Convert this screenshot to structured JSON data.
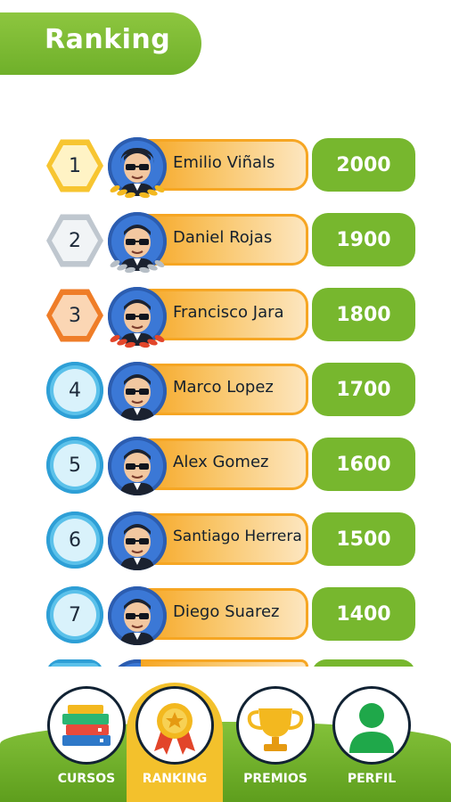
{
  "header": {
    "title": "Ranking"
  },
  "ranking": [
    {
      "rank": "1",
      "name": "Emilio Viñals",
      "score": "2000",
      "medal": "gold"
    },
    {
      "rank": "2",
      "name": "Daniel Rojas",
      "score": "1900",
      "medal": "silver"
    },
    {
      "rank": "3",
      "name": "Francisco Jara",
      "score": "1800",
      "medal": "bronze"
    },
    {
      "rank": "4",
      "name": "Marco Lopez",
      "score": "1700",
      "medal": "none"
    },
    {
      "rank": "5",
      "name": "Alex Gomez",
      "score": "1600",
      "medal": "none"
    },
    {
      "rank": "6",
      "name": "Santiago Herrera",
      "score": "1500",
      "medal": "none"
    },
    {
      "rank": "7",
      "name": "Diego Suarez",
      "score": "1400",
      "medal": "none"
    }
  ],
  "nav": {
    "items": [
      {
        "label": "CURSOS",
        "icon": "books-icon"
      },
      {
        "label": "RANKING",
        "icon": "medal-icon",
        "active": true
      },
      {
        "label": "PREMIOS",
        "icon": "trophy-icon"
      },
      {
        "label": "PERFIL",
        "icon": "user-icon"
      }
    ]
  },
  "colors": {
    "accent_green": "#77b72e",
    "gold": "#f7c531",
    "silver": "#bfc7cf",
    "bronze": "#ef7d28",
    "blue": "#5bc1ea",
    "namebar_orange": "#f6a623",
    "nav_active": "#f3c12c"
  }
}
